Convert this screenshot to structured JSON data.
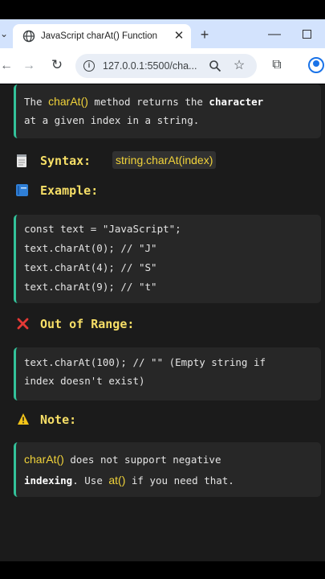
{
  "browser": {
    "tab_title": "JavaScript charAt() Function",
    "tab_close_glyph": "✕",
    "new_tab_glyph": "+",
    "minimize_glyph": "—",
    "url": "127.0.0.1:5500/cha...",
    "prev_tabs_glyph": "⌄",
    "back_glyph": "←",
    "forward_glyph": "→",
    "reload_glyph": "↻",
    "star_glyph": "☆",
    "extensions_glyph": "⧉"
  },
  "content": {
    "intro": {
      "line1_before": "The ",
      "line1_code": "charAt()",
      "line1_mid": " method returns the ",
      "line1_bold": "character",
      "line2": "at a given index in a string."
    },
    "syntax": {
      "label": "Syntax:",
      "code": "string.charAt(index)"
    },
    "example": {
      "label": "Example:",
      "lines": [
        "const text = \"JavaScript\";",
        "text.charAt(0); // \"J\"",
        "text.charAt(4); // \"S\"",
        "text.charAt(9); // \"t\""
      ]
    },
    "out_of_range": {
      "label": "Out of Range:",
      "line1": "text.charAt(100); // \"\" (Empty string if",
      "line2": "index doesn't exist)"
    },
    "note": {
      "label": "Note:",
      "line1_code": "charAt()",
      "line1_rest": " does not support negative",
      "line2_bold": "indexing",
      "line2_mid": ". Use ",
      "line2_code": "at()",
      "line2_rest": " if you need that."
    }
  },
  "colors": {
    "page_bg": "#1b1b1b",
    "card_bg": "#272727",
    "card_accent": "#33c29a",
    "heading": "#f7df67",
    "code_highlight": "#f1d33a",
    "tab_strip": "#d3e3fd"
  },
  "icons": {
    "tab_favicon": "globe-icon",
    "syntax_heading": "memo-icon",
    "example_heading": "blue-book-icon",
    "out_of_range_heading": "cross-mark-icon",
    "note_heading": "warning-icon"
  }
}
